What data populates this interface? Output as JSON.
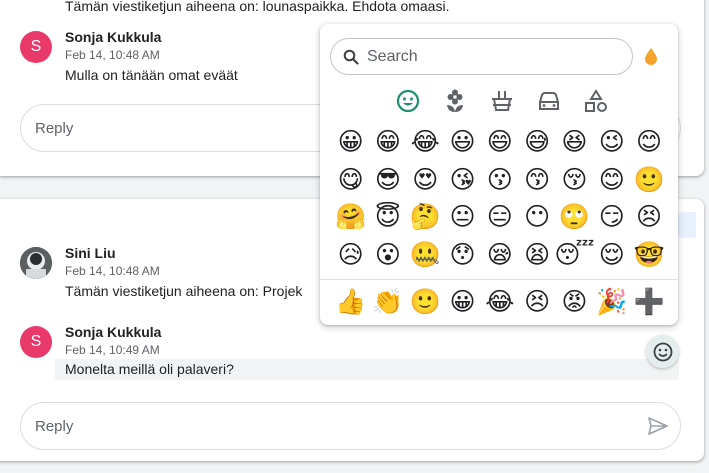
{
  "top_thread": {
    "snippet": "Tämän viestiketjun aiheena on: lounaspaikka. Ehdota omaasi.",
    "message": {
      "avatar_letter": "S",
      "sender": "Sonja Kukkula",
      "time": "Feb 14, 10:48 AM",
      "body": "Mulla on tänään omat eväät"
    },
    "reply_placeholder": "Reply"
  },
  "bottom_thread": {
    "messages": [
      {
        "sender": "Sini Liu",
        "time": "Feb 14, 10:48 AM",
        "body": "Tämän viestiketjun aiheena on: Projek"
      },
      {
        "avatar_letter": "S",
        "sender": "Sonja Kukkula",
        "time": "Feb 14, 10:49 AM",
        "body": "Monelta meillä oli palaveri?"
      }
    ],
    "reply_placeholder": "Reply"
  },
  "emoji_picker": {
    "search_placeholder": "Search",
    "categories": [
      "smileys-icon",
      "nature-icon",
      "food-icon",
      "travel-icon",
      "symbols-icon"
    ],
    "grid": [
      "😀",
      "😁",
      "😂",
      "😃",
      "😄",
      "😅",
      "😆",
      "😉",
      "😊",
      "😋",
      "😎",
      "😍",
      "😘",
      "😗",
      "😙",
      "😚",
      "😊",
      "🙂",
      "🤗",
      "😇",
      "🤔",
      "😐",
      "😑",
      "😶",
      "🙄",
      "😏",
      "😣",
      "😥",
      "😮",
      "🤐",
      "😯",
      "😪",
      "😫",
      "😴",
      "😌",
      "🤓"
    ],
    "recent": [
      "👍",
      "👏",
      "🙂",
      "😀",
      "😂",
      "😣",
      "😡",
      "🎉",
      "➕"
    ]
  },
  "colors": {
    "avatar_red": "#e8396a",
    "accent_green": "#1e8e6e",
    "skin_tone": "#f4a42a"
  }
}
